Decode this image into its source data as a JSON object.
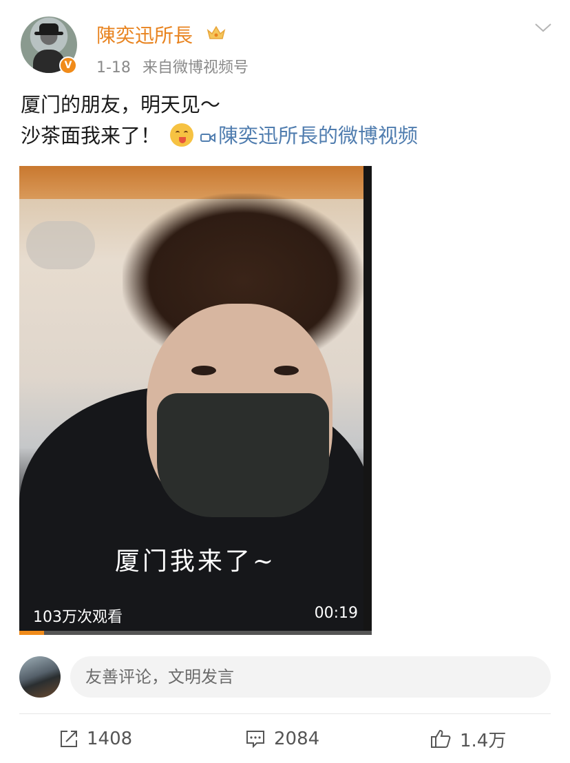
{
  "header": {
    "username": "陳奕迅所長",
    "time": "1-18",
    "source": "来自微博视频号",
    "verified_badge": "V"
  },
  "post": {
    "line1": "厦门的朋友，明天见～",
    "line2": "沙茶面我来了！",
    "emoji": "yummy-face-emoji",
    "video_link": "陳奕迅所長的微博视频"
  },
  "video": {
    "subtitle": "厦门我来了~",
    "views": "103万次观看",
    "duration": "00:19",
    "progress": 0.07
  },
  "comment": {
    "placeholder": "友善评论，文明发言"
  },
  "actions": {
    "repost_count": "1408",
    "comment_count": "2084",
    "like_count": "1.4万"
  },
  "colors": {
    "username": "#e8831f",
    "link": "#507daf",
    "badge": "#f08b1a"
  }
}
